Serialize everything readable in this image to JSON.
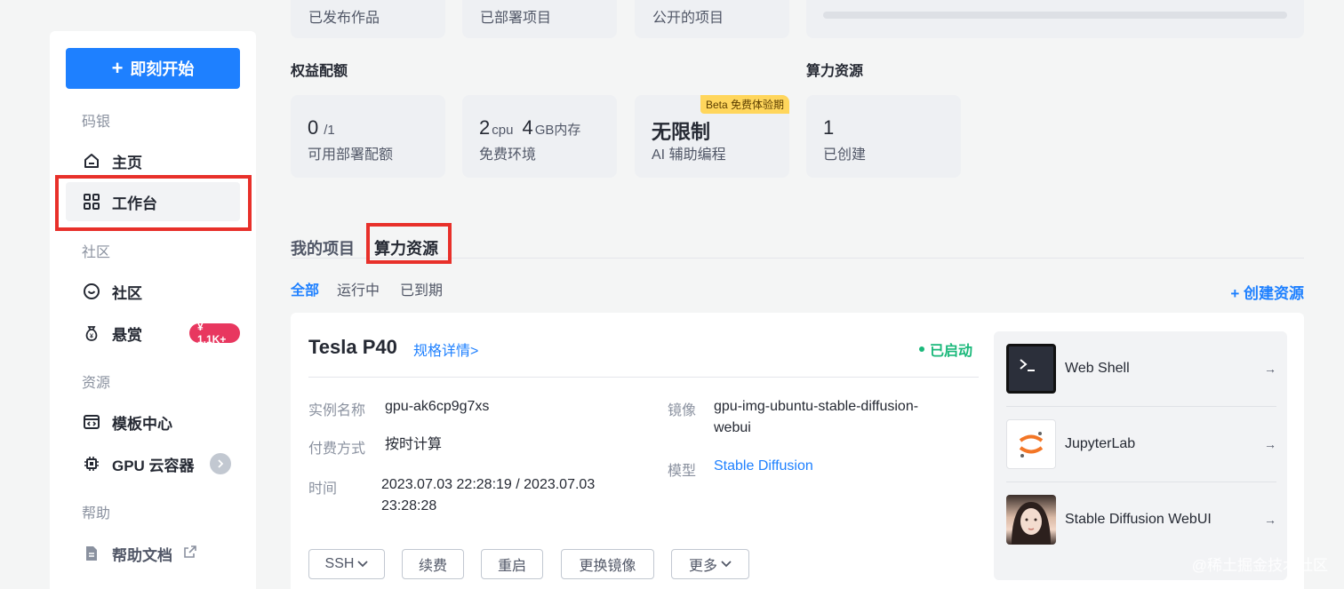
{
  "sidebar": {
    "start_button": "即刻开始",
    "sections": [
      {
        "title": "码银"
      },
      {
        "title": "社区"
      },
      {
        "title": "资源"
      },
      {
        "title": "帮助"
      }
    ],
    "items": {
      "home": "主页",
      "workbench": "工作台",
      "community": "社区",
      "bounty": "悬赏",
      "bounty_badge": "¥ 1.1K+",
      "templates": "模板中心",
      "gpu": "GPU 云容器",
      "docs": "帮助文档"
    }
  },
  "stats_top": [
    "已发布作品",
    "已部署项目",
    "公开的项目"
  ],
  "quota": {
    "heading": "权益配额",
    "cards": [
      {
        "value": "0",
        "unit": "/1",
        "label": "可用部署配额"
      },
      {
        "v1": "2",
        "u1": "cpu",
        "v2": "4",
        "u2": "GB内存",
        "label": "免费环境"
      },
      {
        "value": "无限制",
        "label": "AI 辅助编程",
        "badge": "Beta 免费体验期"
      }
    ]
  },
  "compute": {
    "heading": "算力资源",
    "count": "1",
    "label": "已创建"
  },
  "tabs": {
    "my_projects": "我的项目",
    "compute": "算力资源"
  },
  "filters": {
    "all": "全部",
    "running": "运行中",
    "expired": "已到期"
  },
  "create_resource": "+ 创建资源",
  "resource": {
    "gpu": "Tesla P40",
    "spec_link": "规格详情>",
    "status": "已启动",
    "fields": {
      "instance_label": "实例名称",
      "instance_value": "gpu-ak6cp9g7xs",
      "billing_label": "付费方式",
      "billing_value": "按时计算",
      "time_label": "时间",
      "time_value_1": "2023.07.03 22:28:19 / 2023.07.03",
      "time_value_2": "23:28:28",
      "image_label": "镜像",
      "image_value_1": "gpu-img-ubuntu-stable-diffusion-",
      "image_value_2": "webui",
      "model_label": "模型",
      "model_value": "Stable Diffusion"
    },
    "actions": [
      "SSH",
      "续费",
      "重启",
      "更换镜像",
      "更多"
    ],
    "apps": [
      "Web Shell",
      "JupyterLab",
      "Stable Diffusion WebUI"
    ]
  },
  "watermark": "@稀土掘金技术社区",
  "colors": {
    "accent": "#1e80ff",
    "success": "#1ab87a",
    "highlight": "#e8302a",
    "badge": "#e8375f"
  }
}
